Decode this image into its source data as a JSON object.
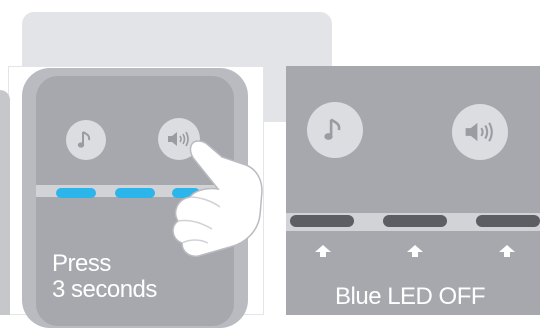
{
  "left_panel": {
    "caption_line1": "Press",
    "caption_line2": "3 seconds",
    "buttons": [
      {
        "icon": "music-note-icon"
      },
      {
        "icon": "speaker-volume-icon"
      }
    ],
    "leds": [
      "on",
      "on",
      "on"
    ]
  },
  "right_panel": {
    "caption": "Blue LED OFF",
    "buttons": [
      {
        "icon": "music-note-icon"
      },
      {
        "icon": "speaker-volume-icon"
      }
    ],
    "leds": [
      "off",
      "off",
      "off"
    ]
  },
  "colors": {
    "led_on": "#2bb5ea",
    "led_off": "#5c5e63",
    "panel": "#a6a8ad",
    "button": "#dcdde0"
  }
}
